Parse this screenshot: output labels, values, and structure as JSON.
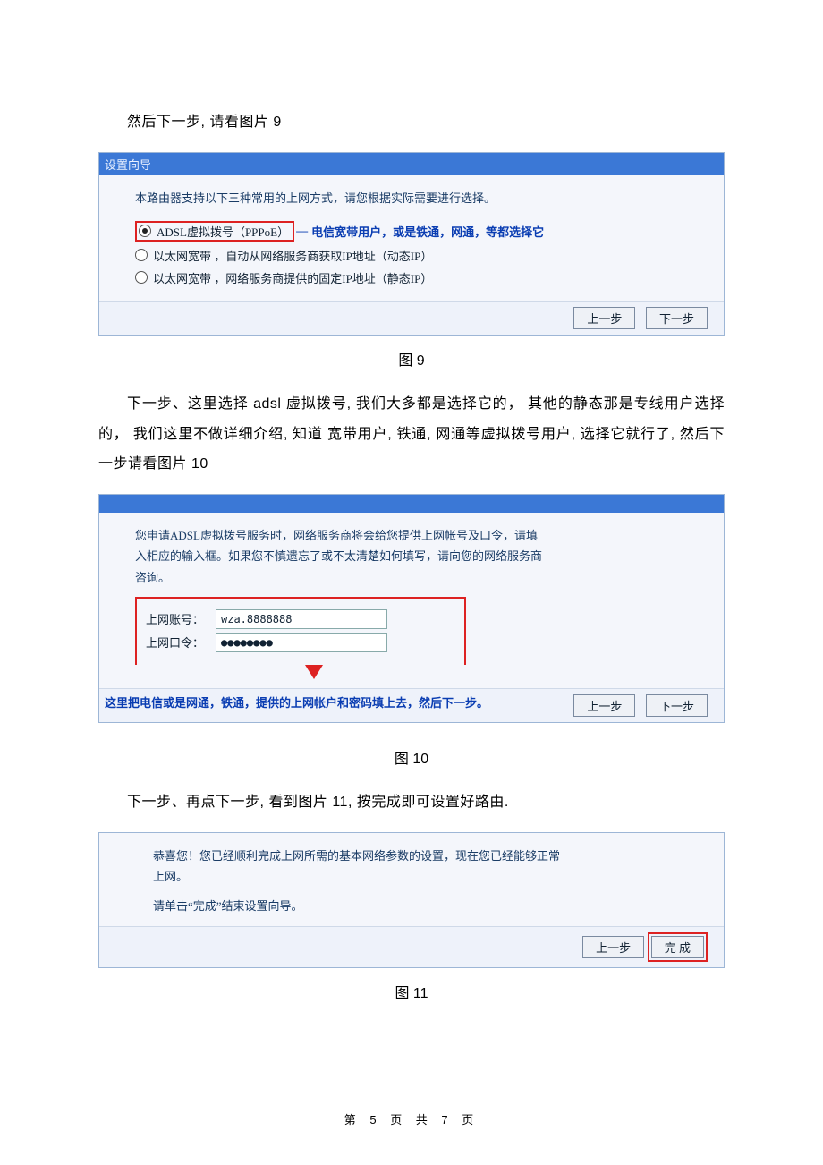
{
  "text": {
    "intro9": "然后下一步, 请看图片 9",
    "cap9": "图 9",
    "para10": "下一步、这里选择 adsl 虚拟拨号, 我们大多都是选择它的，  其他的静态那是专线用户选择的，  我们这里不做详细介绍, 知道  宽带用户, 铁通, 网通等虚拟拨号用户, 选择它就行了, 然后下一步请看图片 10",
    "cap10": "图 10",
    "para11": "下一步、再点下一步, 看到图片 11, 按完成即可设置好路由.",
    "cap11": "图 11",
    "footer": "第 5 页 共 7 页"
  },
  "fig9": {
    "title": "设置向导",
    "intro": "本路由器支持以下三种常用的上网方式，请您根据实际需要进行选择。",
    "opt1": "ADSL虚拟拨号（PPPoE）",
    "annot1": "电信宽带用户，或是铁通，网通，等都选择它",
    "opt2": "以太网宽带 ，自动从网络服务商获取IP地址（动态IP）",
    "opt3": "以太网宽带 ，网络服务商提供的固定IP地址（静态IP）",
    "prev": "上一步",
    "next": "下一步"
  },
  "fig10": {
    "intro": "您申请ADSL虚拟拨号服务时，网络服务商将会给您提供上网帐号及口令，请填入相应的输入框。如果您不慎遗忘了或不太清楚如何填写，请向您的网络服务商咨询。",
    "acct_label": "上网账号：",
    "acct_value": "wza.8888888",
    "pwd_label": "上网口令：",
    "pwd_value": "●●●●●●●●",
    "callout": "这里把电信或是网通，铁通，提供的上网帐户和密码填上去，然后下一步。",
    "prev": "上一步",
    "next": "下一步"
  },
  "fig11": {
    "line1": "恭喜您！您已经顺利完成上网所需的基本网络参数的设置，现在您已经能够正常上网。",
    "line2": "请单击“完成”结束设置向导。",
    "prev": "上一步",
    "finish": "完 成"
  }
}
